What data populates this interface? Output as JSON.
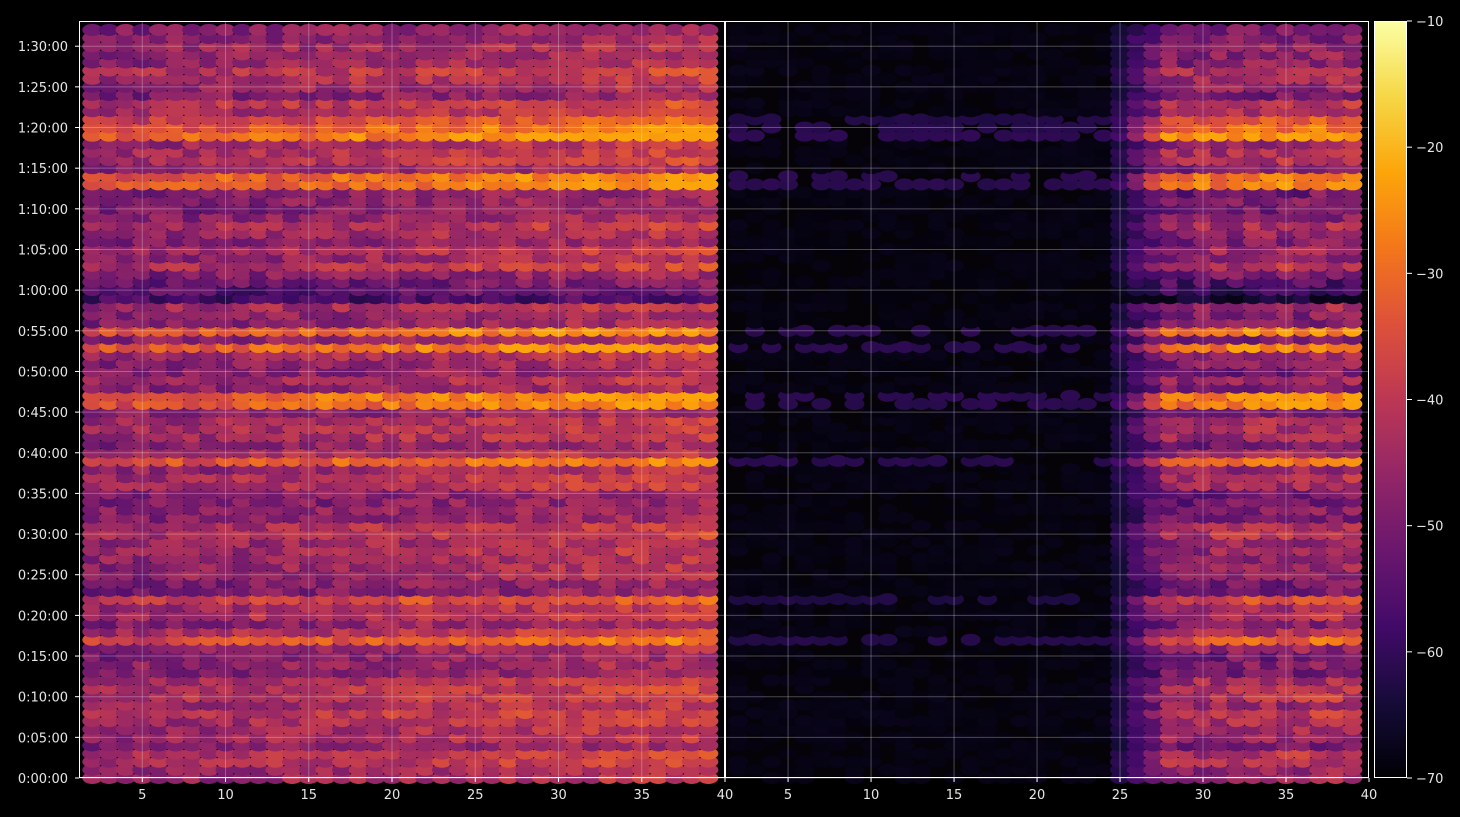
{
  "chart_data": {
    "type": "heatmap",
    "panels": [
      {
        "name": "",
        "x_ticks": [
          "5",
          "10",
          "15",
          "20",
          "25",
          "30",
          "35",
          "40"
        ],
        "x_tick_values": [
          5,
          10,
          15,
          20,
          25,
          30,
          35,
          40
        ],
        "xlim": [
          1.2,
          40
        ],
        "grid": true
      },
      {
        "name": "",
        "x_ticks": [
          "5",
          "10",
          "15",
          "20",
          "25",
          "30",
          "35",
          "40"
        ],
        "x_tick_values": [
          5,
          10,
          15,
          20,
          25,
          30,
          35,
          40
        ],
        "xlim": [
          1.2,
          40
        ],
        "grid": true
      }
    ],
    "y_ticks": [
      "0:00:00",
      "0:05:00",
      "0:10:00",
      "0:15:00",
      "0:20:00",
      "0:25:00",
      "0:30:00",
      "0:35:00",
      "0:40:00",
      "0:45:00",
      "0:50:00",
      "0:55:00",
      "1:00:00",
      "1:05:00",
      "1:10:00",
      "1:15:00",
      "1:20:00",
      "1:25:00",
      "1:30:00"
    ],
    "y_tick_minutes": [
      0,
      5,
      10,
      15,
      20,
      25,
      30,
      35,
      40,
      45,
      50,
      55,
      60,
      65,
      70,
      75,
      80,
      85,
      90
    ],
    "ylim_minutes": [
      0,
      93.1
    ],
    "x_bins": [
      2,
      3,
      4,
      5,
      6,
      7,
      8,
      9,
      10,
      11,
      12,
      13,
      14,
      15,
      16,
      17,
      18,
      19,
      20,
      21,
      22,
      23,
      24,
      25,
      26,
      27,
      28,
      29,
      30,
      31,
      32,
      33,
      34,
      35,
      36,
      37,
      38,
      39
    ],
    "row_step_minutes": 1,
    "colorbar": {
      "colormap": "inferno",
      "min": -70,
      "max": -10,
      "ticks": [
        "−10",
        "−20",
        "−30",
        "−40",
        "−50",
        "−60",
        "−70"
      ],
      "tick_values": [
        -10,
        -20,
        -30,
        -40,
        -50,
        -60,
        -70
      ]
    },
    "hot_rows_minutes": [
      17,
      22,
      39,
      46,
      47,
      53,
      55,
      79,
      80,
      81,
      74,
      73
    ],
    "left_panel_level_range": [
      -62,
      -22
    ],
    "right_panel_onset_bin": 25,
    "colors": {
      "background": "#000000",
      "frame": "#ffffff",
      "grid": "#ffffff",
      "text": "#e6e6e6"
    }
  }
}
